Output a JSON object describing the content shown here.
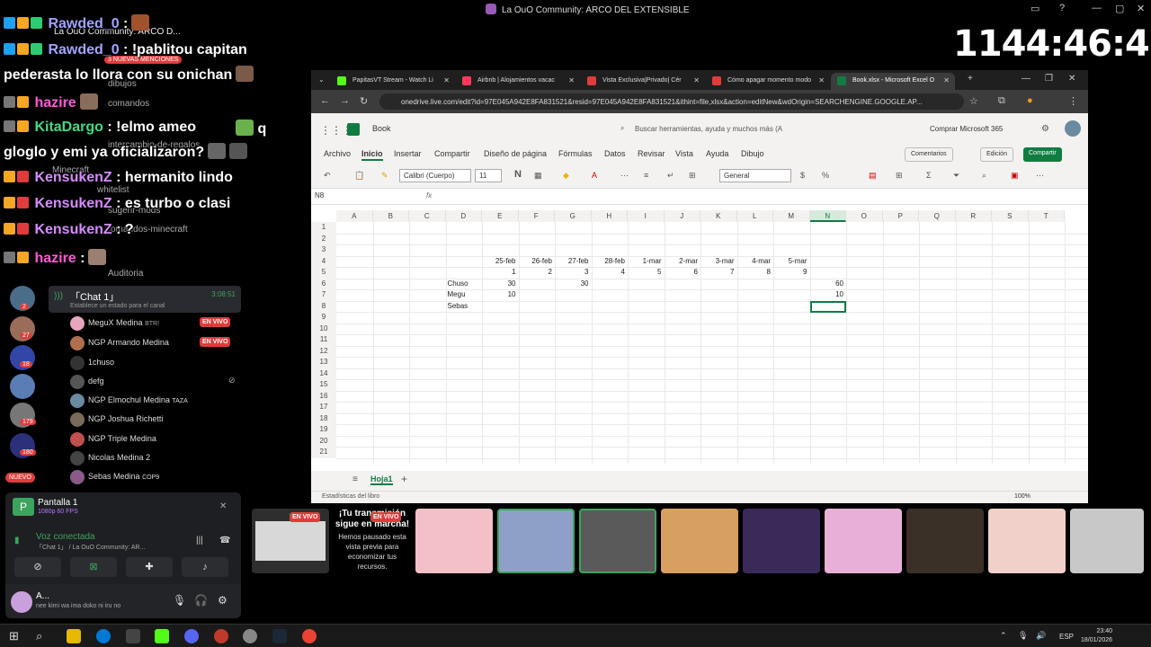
{
  "window": {
    "title": "La OuO Community: ARCO DEL EXTENSIBLE"
  },
  "timer": "1144:46:43",
  "chat": [
    {
      "user": "Rawded_0",
      "msg": ":",
      "color": "#a3a3ff"
    },
    {
      "user": "Rawded_0",
      "msg": ": !pablitou capitan",
      "color": "#a3a3ff"
    },
    {
      "user": "",
      "msg": "pederasta lo llora con su onichan",
      "color": "#ffffff"
    },
    {
      "user": "hazire",
      "msg": "",
      "color": "#ff5ad6"
    },
    {
      "user": "KitaDargo",
      "msg": ": !elmo ameo",
      "color": "#3ddc84"
    },
    {
      "user": "",
      "msg": "gloglo y emi ya oficializaron?",
      "color": "#ffffff"
    },
    {
      "user": "KensukenZ",
      "msg": ": hermanito lindo",
      "color": "#d68cff"
    },
    {
      "user": "KensukenZ",
      "msg": ": es turbo o clasi",
      "color": "#d68cff"
    },
    {
      "user": "KensukenZ",
      "msg": ": ?",
      "color": "#d68cff"
    },
    {
      "user": "hazire",
      "msg": ":",
      "color": "#ff5ad6"
    }
  ],
  "chat_q": "q",
  "mentions_badge": "3 NUEVAS MENCIONES",
  "faint_channels": [
    "La OuO Community: ARCO D...",
    "dibujos",
    "comandos",
    "intercambio-de-regalos",
    "whitelist",
    "sugerir-mods",
    "comandos-minecraft",
    "Minecraft",
    "Auditoria"
  ],
  "server_badges": [
    "62",
    "2",
    "27",
    "18",
    "179",
    "180"
  ],
  "nuevo": "NUEVO",
  "voice_channel": {
    "name": "「Chat 1」",
    "time": "3:08:51",
    "status": "Establece un estado para el canal"
  },
  "voice_users": [
    {
      "name": "MeguX Medina",
      "tag": "BTR!",
      "live": "EN VIVO"
    },
    {
      "name": "NGP Armando Medina",
      "tag": "",
      "live": "EN VIVO"
    },
    {
      "name": "1chuso",
      "tag": "",
      "live": ""
    },
    {
      "name": "defg",
      "tag": "",
      "live": ""
    },
    {
      "name": "NGP Elmochul Medina",
      "tag": "TAZA",
      "live": ""
    },
    {
      "name": "NGP Joshua Richetti",
      "tag": "",
      "live": ""
    },
    {
      "name": "NGP Triple Medina",
      "tag": "",
      "live": ""
    },
    {
      "name": "Nicolas Medina 2",
      "tag": "",
      "live": ""
    },
    {
      "name": "Sebas Medina",
      "tag": "COP9",
      "live": ""
    }
  ],
  "panel": {
    "screen_title": "Pantalla 1",
    "screen_sub": "1080p 60 FPS",
    "voice_title": "Voz conectada",
    "voice_sub": "「Chat 1」 / La OuO Community: AR...",
    "user_name": "A...",
    "user_status": "nee kimi wa ima doko ni iru no"
  },
  "browser": {
    "tabs": [
      {
        "label": "PapitasVT Stream - Watch Li",
        "color": "#53fc18"
      },
      {
        "label": "Airbnb | Alojamientos vacac",
        "color": "#ff385c"
      },
      {
        "label": "Vista Exclusiva|Privado| Cér",
        "color": "#e03c3c"
      },
      {
        "label": "Cómo apagar momento modo",
        "color": "#e03c3c"
      },
      {
        "label": "Book.xlsx - Microsoft Excel O",
        "color": "#107c41"
      }
    ],
    "url": "onedrive.live.com/edit?id=97E045A942E8FA831521&resid=97E045A942E8FA831521&ithint=file,xlsx&action=editNew&wdOrigin=SEARCHENGINE.GOOGLE.AP..."
  },
  "excel": {
    "book": "Book",
    "search_placeholder": "Buscar herramientas, ayuda y muchos más (A",
    "buy": "Comprar Microsoft 365",
    "menu": [
      "Archivo",
      "Inicio",
      "Insertar",
      "Compartir",
      "Diseño de página",
      "Fórmulas",
      "Datos",
      "Revisar",
      "Vista",
      "Ayuda",
      "Dibujo"
    ],
    "comments": "Comentarios",
    "edit": "Edición",
    "share": "Compartir",
    "font": "Calibri (Cuerpo)",
    "size": "11",
    "format": "General",
    "namebox": "N8",
    "fx": "fx",
    "columns": [
      "A",
      "B",
      "C",
      "D",
      "E",
      "F",
      "G",
      "H",
      "I",
      "J",
      "K",
      "L",
      "M",
      "N",
      "O",
      "P",
      "Q",
      "R",
      "S",
      "T"
    ],
    "rows": [
      "1",
      "2",
      "3",
      "4",
      "5",
      "6",
      "7",
      "8",
      "9",
      "10",
      "11",
      "12",
      "13",
      "14",
      "15",
      "16",
      "17",
      "18",
      "19",
      "20",
      "21"
    ],
    "dates": [
      "25-feb",
      "26-feb",
      "27-feb",
      "28-feb",
      "1-mar",
      "2-mar",
      "3-mar",
      "4-mar",
      "5-mar"
    ],
    "nums": [
      "1",
      "2",
      "3",
      "4",
      "5",
      "6",
      "7",
      "8",
      "9"
    ],
    "names": [
      "Chuso",
      "Megu",
      "Sebas"
    ],
    "values": {
      "chuso_e": "30",
      "chuso_g": "30",
      "chuso_n": "60",
      "megu_e": "10",
      "megu_n": "10"
    },
    "sheet": "Hoja1",
    "status": "Estadísticas del libro",
    "zoom": "100%"
  },
  "stream_tiles": {
    "live": "EN VIVO",
    "msg_title": "¡Tu transmisión sigue en marcha!",
    "msg_body": "Hemos pausado esta vista previa para economizar tus recursos."
  },
  "taskbar": {
    "lang": "ESP",
    "time": "23:40",
    "date": "18/01/2026"
  }
}
